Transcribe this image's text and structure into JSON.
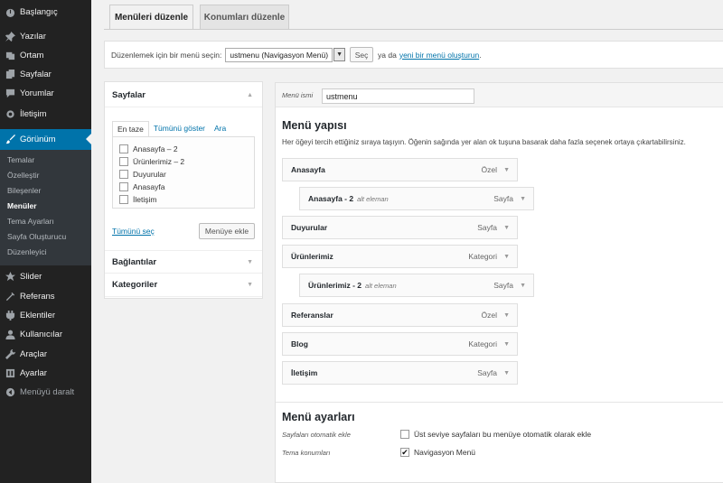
{
  "sidebar": {
    "items": [
      {
        "label": "Başlangıç",
        "icon": "dashboard-icon"
      },
      {
        "label": "Yazılar",
        "icon": "pin-icon"
      },
      {
        "label": "Ortam",
        "icon": "media-icon"
      },
      {
        "label": "Sayfalar",
        "icon": "pages-icon"
      },
      {
        "label": "Yorumlar",
        "icon": "comments-icon"
      },
      {
        "label": "İletişim",
        "icon": "contact-icon"
      },
      {
        "label": "Görünüm",
        "icon": "appearance-icon"
      },
      {
        "label": "Slider",
        "icon": "star-icon"
      },
      {
        "label": "Referans",
        "icon": "tools-icon"
      },
      {
        "label": "Eklentiler",
        "icon": "plugins-icon"
      },
      {
        "label": "Kullanıcılar",
        "icon": "users-icon"
      },
      {
        "label": "Araçlar",
        "icon": "wrench-icon"
      },
      {
        "label": "Ayarlar",
        "icon": "settings-icon"
      },
      {
        "label": "Menüyü daralt",
        "icon": "collapse-icon"
      }
    ],
    "submenu": [
      "Temalar",
      "Özelleştir",
      "Bileşenler",
      "Menüler",
      "Tema Ayarları",
      "Sayfa Oluşturucu",
      "Düzenleyici"
    ]
  },
  "tabs": {
    "edit": "Menüleri düzenle",
    "locations": "Konumları düzenle"
  },
  "selectbar": {
    "label": "Düzenlemek için bir menü seçin:",
    "selected": "ustmenu (Navigasyon Menü)",
    "button": "Seç",
    "or_text": "ya da",
    "create_link": "yeni bir menü oluşturun",
    "end": "."
  },
  "pages_panel": {
    "title": "Sayfalar",
    "subtabs": [
      "En taze",
      "Tümünü göster",
      "Ara"
    ],
    "items": [
      "Anasayfa – 2",
      "Ürünlerimiz – 2",
      "Duyurular",
      "Anasayfa",
      "İletişim"
    ],
    "select_all": "Tümünü seç",
    "add_button": "Menüye ekle"
  },
  "links_panel": {
    "title": "Bağlantılar"
  },
  "categories_panel": {
    "title": "Kategoriler"
  },
  "menu": {
    "name_label": "Menü ismi",
    "name_value": "ustmenu",
    "structure_title": "Menü yapısı",
    "structure_desc": "Her öğeyi tercih ettiğiniz sıraya taşıyın. Öğenin sağında yer alan ok tuşuna basarak daha fazla seçenek ortaya çıkartabilirsiniz.",
    "items": [
      {
        "label": "Anasayfa",
        "sub": "",
        "type": "Özel"
      },
      {
        "label": "Anasayfa - 2",
        "sub": "alt eleman",
        "type": "Sayfa"
      },
      {
        "label": "Duyurular",
        "sub": "",
        "type": "Sayfa"
      },
      {
        "label": "Ürünlerimiz",
        "sub": "",
        "type": "Kategori"
      },
      {
        "label": "Ürünlerimiz - 2",
        "sub": "alt eleman",
        "type": "Sayfa"
      },
      {
        "label": "Referanslar",
        "sub": "",
        "type": "Özel"
      },
      {
        "label": "Blog",
        "sub": "",
        "type": "Kategori"
      },
      {
        "label": "İletişim",
        "sub": "",
        "type": "Sayfa"
      }
    ],
    "settings_title": "Menü ayarları",
    "auto_add_label": "Sayfaları otomatik ekle",
    "auto_add_text": "Üst seviye sayfaları bu menüye otomatik olarak ekle",
    "auto_add_checked": false,
    "locations_label": "Tema konumları",
    "location_text": "Navigasyon Menü",
    "location_checked": true
  },
  "colors": {
    "sidebar_bg": "#222222",
    "active_bg": "#0073aa",
    "link": "#0073aa"
  }
}
